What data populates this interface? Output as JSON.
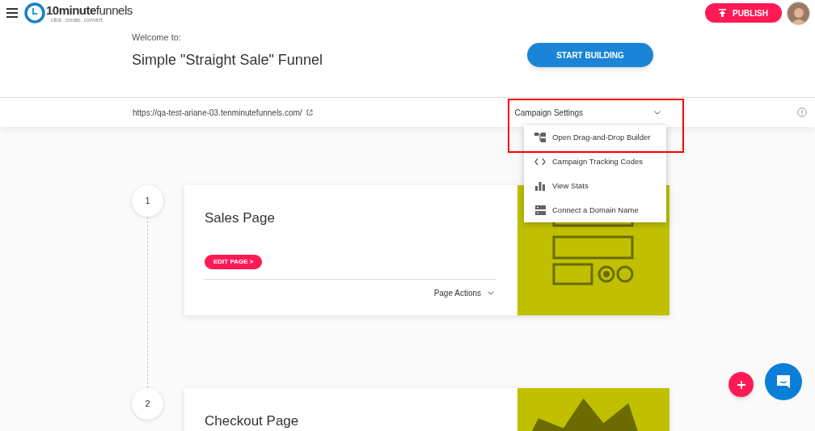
{
  "header": {
    "logo": {
      "wordmark_bold": "10minute",
      "wordmark_light": "funnels",
      "tagline": "click. create. convert."
    },
    "publish_button": "PUBLISH"
  },
  "welcome": {
    "label": "Welcome to:",
    "title": "Simple \"Straight Sale\" Funnel",
    "start_button": "START BUILDING"
  },
  "url_bar": {
    "url": "https://qa-test-ariane-03.tenminutefunnels.com/",
    "settings_label": "Campaign Settings"
  },
  "settings_menu": {
    "expanded": true,
    "outlined": true,
    "items": [
      {
        "kind": "builder",
        "label": "Open Drag-and-Drop Builder"
      },
      {
        "kind": "code",
        "label": "Campaign Tracking Codes"
      },
      {
        "kind": "stats",
        "label": "View Stats"
      },
      {
        "kind": "domain",
        "label": "Connect a Domain Name"
      }
    ]
  },
  "steps": [
    {
      "number": "1",
      "title": "Sales Page",
      "edit_button": "EDIT PAGE >",
      "actions_label": "Page Actions"
    },
    {
      "number": "2",
      "title": "Checkout Page"
    }
  ]
}
